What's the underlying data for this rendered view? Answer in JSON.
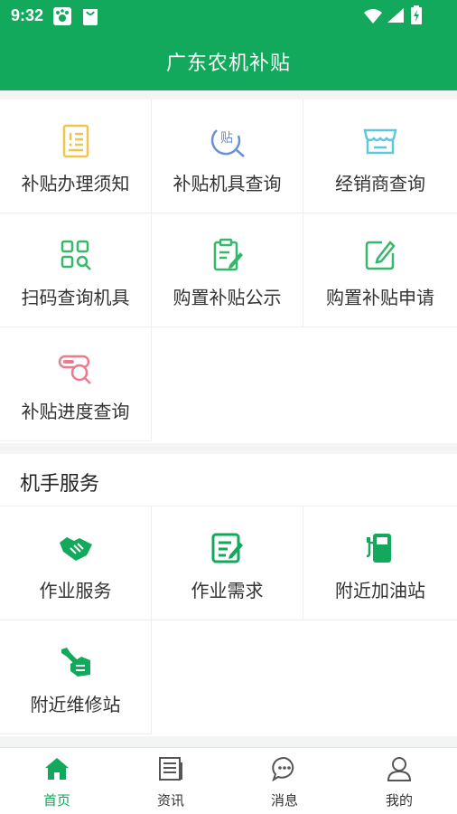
{
  "status_bar": {
    "time": "9:32"
  },
  "app_bar": {
    "title": "广东农机补贴"
  },
  "subsidy_grid": {
    "items": [
      {
        "label": "补贴办理须知",
        "icon": "notice-document-icon",
        "color": "#f0c54c"
      },
      {
        "label": "补贴机具查询",
        "icon": "subsidy-search-icon",
        "color": "#6b8fd6"
      },
      {
        "label": "经销商查询",
        "icon": "store-icon",
        "color": "#5cc8e0"
      },
      {
        "label": "扫码查询机具",
        "icon": "scan-grid-icon",
        "color": "#35b86a"
      },
      {
        "label": "购置补贴公示",
        "icon": "clipboard-edit-icon",
        "color": "#35b86a"
      },
      {
        "label": "购置补贴申请",
        "icon": "edit-square-icon",
        "color": "#35b86a"
      },
      {
        "label": "补贴进度查询",
        "icon": "progress-search-icon",
        "color": "#ee7b8d"
      }
    ]
  },
  "operator_section": {
    "title": "机手服务",
    "items": [
      {
        "label": "作业服务",
        "icon": "handshake-icon",
        "color": "#12a95c"
      },
      {
        "label": "作业需求",
        "icon": "notepad-icon",
        "color": "#12a95c"
      },
      {
        "label": "附近加油站",
        "icon": "gas-station-icon",
        "color": "#12a95c"
      },
      {
        "label": "附近维修站",
        "icon": "wrench-hand-icon",
        "color": "#12a95c"
      }
    ]
  },
  "tab_bar": {
    "tabs": [
      {
        "label": "首页",
        "icon": "home-icon",
        "active": true
      },
      {
        "label": "资讯",
        "icon": "news-icon",
        "active": false
      },
      {
        "label": "消息",
        "icon": "message-icon",
        "active": false
      },
      {
        "label": "我的",
        "icon": "user-icon",
        "active": false
      }
    ]
  },
  "colors": {
    "primary": "#12a95c",
    "divider": "#eeeeee",
    "background": "#f3f5f5"
  }
}
